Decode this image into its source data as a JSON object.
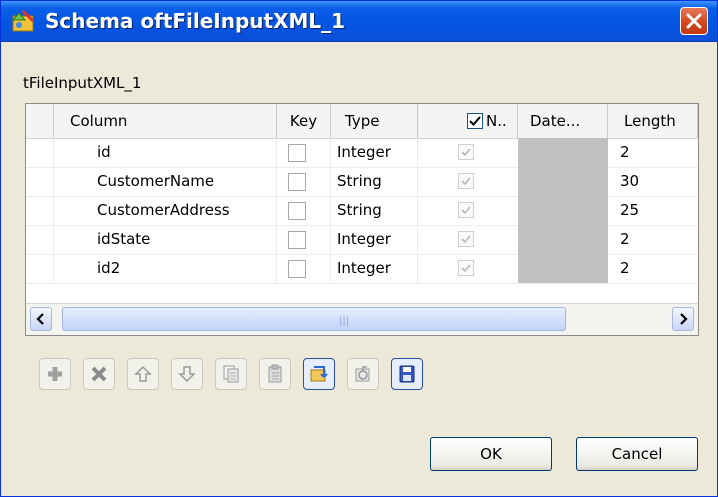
{
  "window": {
    "title": "Schema oftFileInputXML_1"
  },
  "component_name": "tFileInputXML_1",
  "table": {
    "columns": [
      "Column",
      "Key",
      "Type",
      "N..",
      "Date...",
      "Length"
    ],
    "rows": [
      {
        "column": "id",
        "type": "Integer",
        "length": "2",
        "key": false,
        "nullable": true
      },
      {
        "column": "CustomerName",
        "type": "String",
        "length": "30",
        "key": false,
        "nullable": true
      },
      {
        "column": "CustomerAddress",
        "type": "String",
        "length": "25",
        "key": false,
        "nullable": true
      },
      {
        "column": "idState",
        "type": "Integer",
        "length": "2",
        "key": false,
        "nullable": true
      },
      {
        "column": "id2",
        "type": "Integer",
        "length": "2",
        "key": false,
        "nullable": true
      }
    ],
    "header_nullable_checked": true
  },
  "toolbar": {
    "icons": [
      "add-icon",
      "remove-icon",
      "move-up-icon",
      "move-down-icon",
      "copy-icon",
      "paste-icon",
      "import-icon",
      "export-icon",
      "save-icon"
    ]
  },
  "buttons": {
    "ok": "OK",
    "cancel": "Cancel"
  },
  "colors": {
    "titlebar": "#0554e3",
    "dialog": "#ece9d8",
    "close": "#d3461e",
    "date_cell": "#c0c0c0"
  }
}
